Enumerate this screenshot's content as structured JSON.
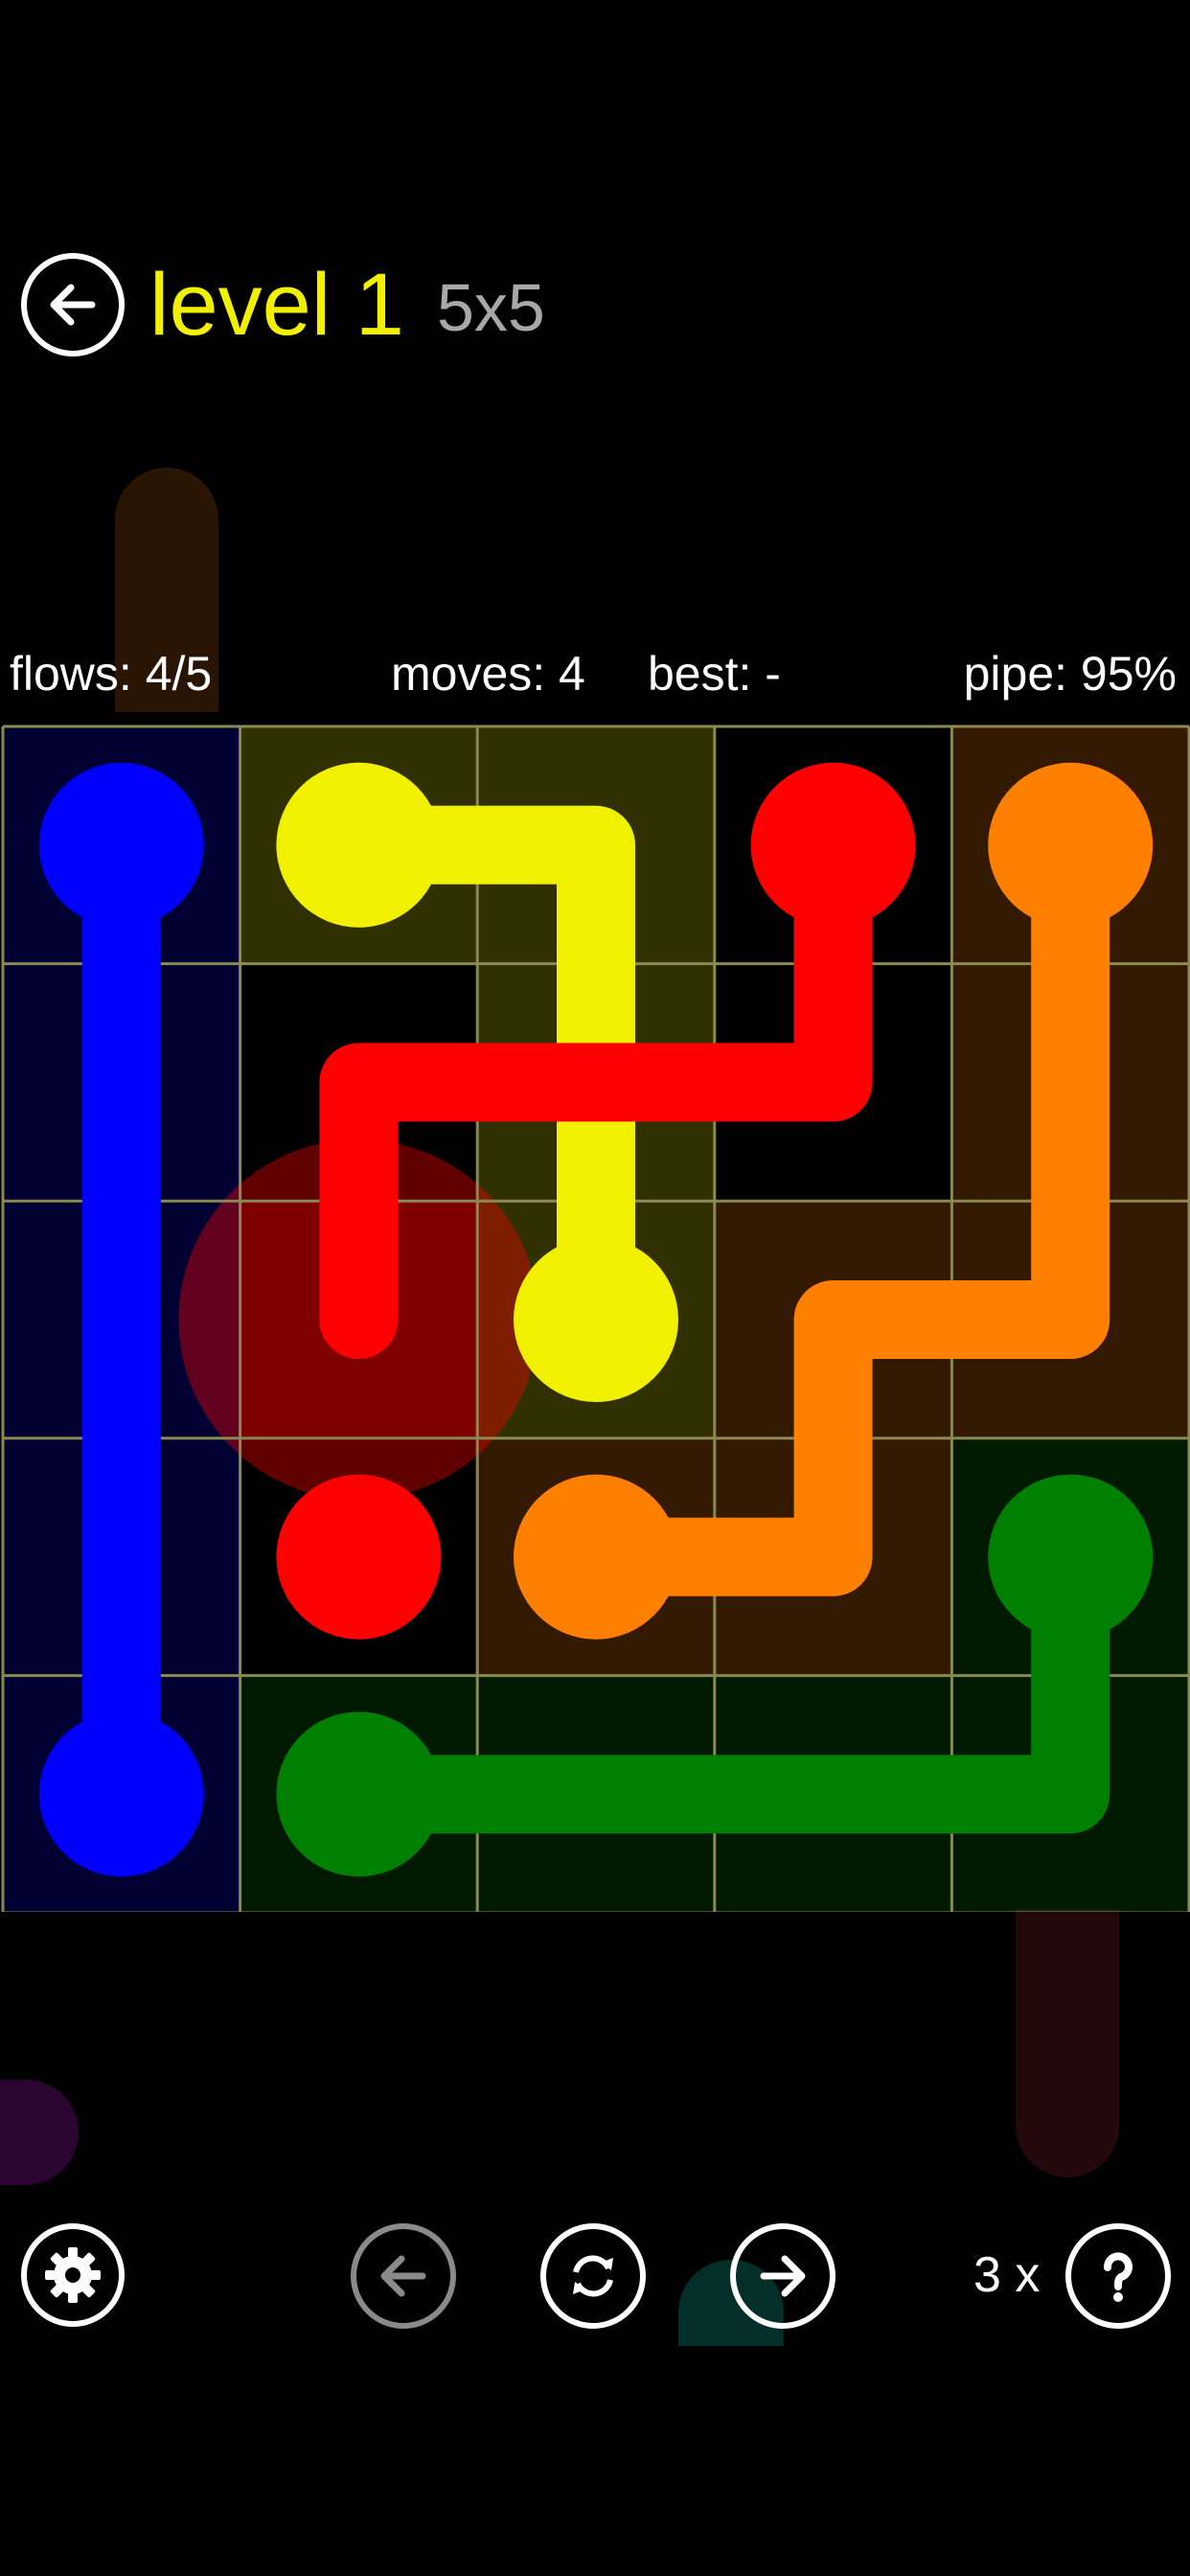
{
  "header": {
    "back_icon": "arrow-left-icon",
    "level_label": "level 1",
    "size_label": "5x5",
    "level_color": "#F0F000",
    "size_color": "#A8A8A8"
  },
  "stats": {
    "flows": "flows: 4/5",
    "moves": "moves: 4",
    "best": "best: -",
    "pipe": "pipe: 95%"
  },
  "board": {
    "rows": 5,
    "cols": 5,
    "grid_color": "#8A8A50",
    "cell_fills": [
      [
        "blue",
        "yellow",
        "yellow",
        null,
        "orange"
      ],
      [
        "blue",
        null,
        "yellow",
        null,
        "orange"
      ],
      [
        "blue",
        "red",
        "yellow",
        "orange",
        "orange"
      ],
      [
        "blue",
        null,
        "orange",
        "orange",
        "green"
      ],
      [
        "blue",
        "green",
        "green",
        "green",
        "green"
      ]
    ],
    "flows": [
      {
        "color": "blue",
        "hex": "#0000FF",
        "endpoints": [
          [
            0,
            0
          ],
          [
            4,
            0
          ]
        ],
        "path": [
          [
            0,
            0
          ],
          [
            1,
            0
          ],
          [
            2,
            0
          ],
          [
            3,
            0
          ],
          [
            4,
            0
          ]
        ]
      },
      {
        "color": "yellow",
        "hex": "#F0F000",
        "endpoints": [
          [
            0,
            1
          ],
          [
            2,
            2
          ]
        ],
        "path": [
          [
            0,
            1
          ],
          [
            0,
            2
          ],
          [
            1,
            2
          ],
          [
            2,
            2
          ]
        ]
      },
      {
        "color": "red",
        "hex": "#FF0000",
        "endpoints": [
          [
            0,
            3
          ],
          [
            3,
            1
          ]
        ],
        "path": [
          [
            0,
            3
          ],
          [
            1,
            3
          ],
          [
            1,
            2
          ],
          [
            1,
            1
          ],
          [
            2,
            1
          ]
        ]
      },
      {
        "color": "orange",
        "hex": "#FF7F00",
        "endpoints": [
          [
            0,
            4
          ],
          [
            3,
            2
          ]
        ],
        "path": [
          [
            0,
            4
          ],
          [
            1,
            4
          ],
          [
            2,
            4
          ],
          [
            2,
            3
          ],
          [
            3,
            3
          ],
          [
            3,
            2
          ]
        ]
      },
      {
        "color": "green",
        "hex": "#008000",
        "endpoints": [
          [
            3,
            4
          ],
          [
            4,
            1
          ]
        ],
        "path": [
          [
            3,
            4
          ],
          [
            4,
            4
          ],
          [
            4,
            3
          ],
          [
            4,
            2
          ],
          [
            4,
            1
          ]
        ]
      }
    ],
    "touch_highlight": {
      "cell": [
        2,
        1
      ],
      "color": "#FF0000"
    }
  },
  "footer": {
    "settings_icon": "gear-icon",
    "prev_icon": "arrow-left-icon",
    "restart_icon": "restart-icon",
    "next_icon": "arrow-right-icon",
    "hints_label": "3 x",
    "help_icon": "question-icon"
  }
}
